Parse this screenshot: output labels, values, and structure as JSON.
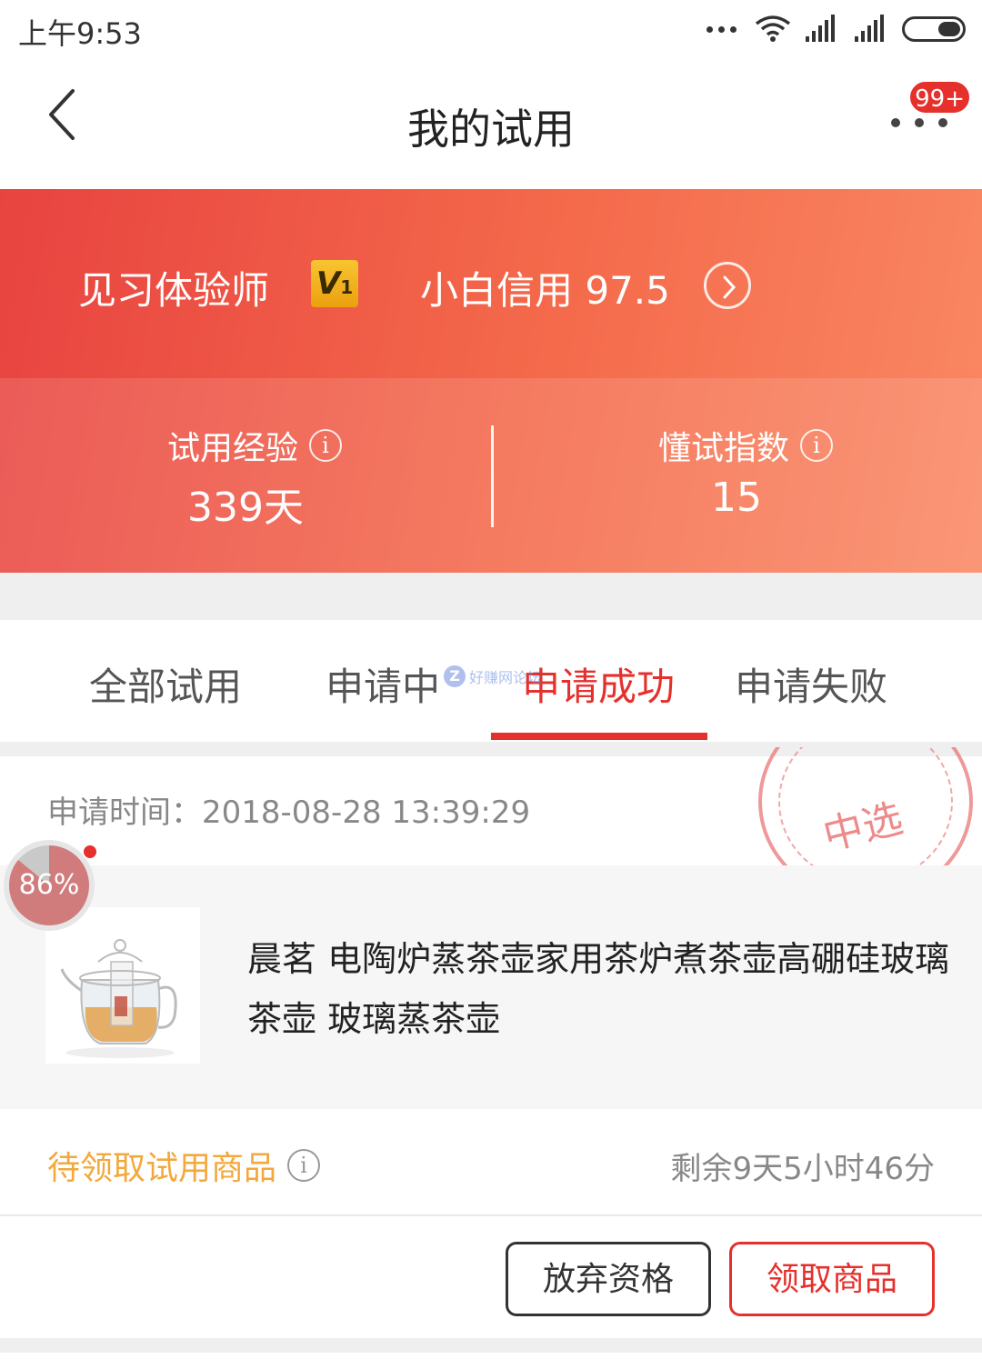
{
  "status_bar": {
    "time": "上午9:53"
  },
  "header": {
    "title": "我的试用",
    "badge": "99+"
  },
  "banner": {
    "level_name": "见习体验师",
    "vip_letter": "V",
    "vip_number": "1",
    "credit_text": "小白信用 97.5",
    "stats": [
      {
        "label": "试用经验",
        "value": "339天"
      },
      {
        "label": "懂试指数",
        "value": "15"
      }
    ]
  },
  "tabs": [
    {
      "label": "全部试用",
      "active": false
    },
    {
      "label": "申请中",
      "active": false
    },
    {
      "label": "申请成功",
      "active": true
    },
    {
      "label": "申请失败",
      "active": false
    }
  ],
  "watermark": "好赚网论坛",
  "card": {
    "apply_time": "申请时间：2018-08-28 13:39:29",
    "stamp": "中选",
    "progress": "86%",
    "product_title": "晨茗 电陶炉蒸茶壶家用茶炉煮茶壶高硼硅玻璃茶壶 玻璃蒸茶壶",
    "pending_status": "待领取试用商品",
    "remaining": "剩余9天5小时46分",
    "abandon_label": "放弃资格",
    "claim_label": "领取商品"
  },
  "colors": {
    "accent": "#e5302c",
    "banner_start": "#e84340",
    "banner_end": "#fa8863",
    "pending": "#f3a83b"
  }
}
